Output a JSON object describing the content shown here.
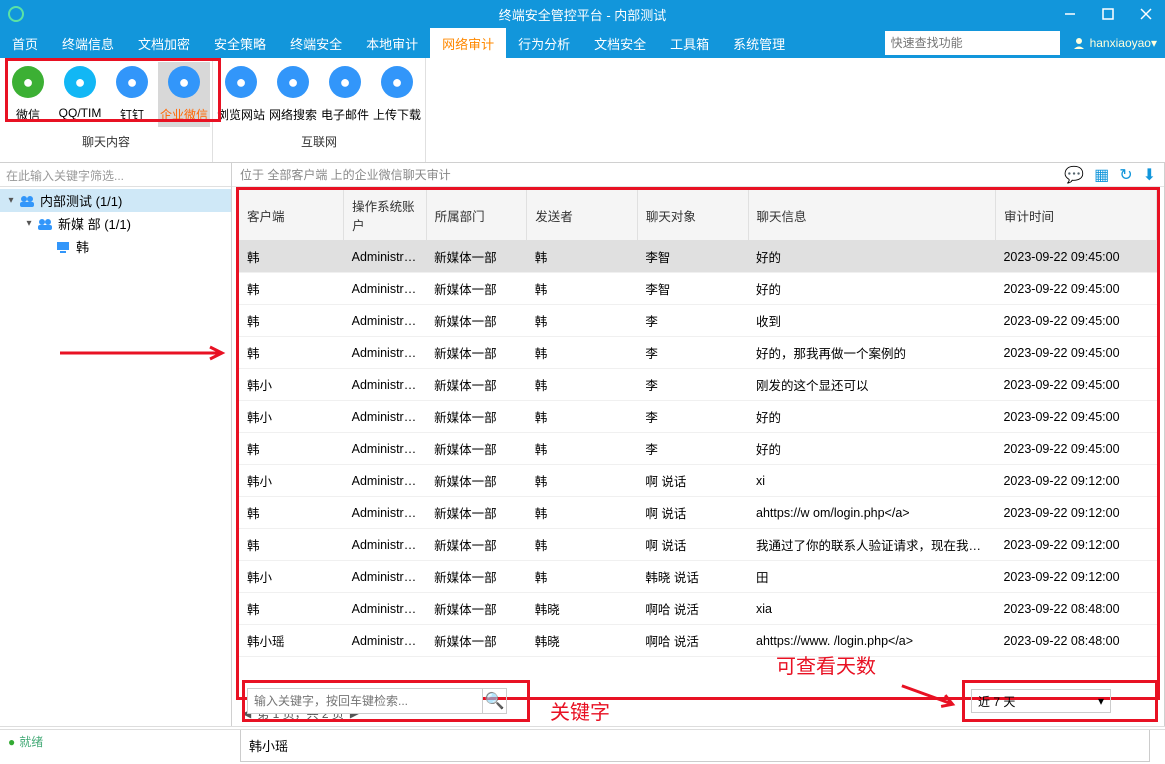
{
  "window": {
    "title": "终端安全管控平台 - 内部测试"
  },
  "user": {
    "name": "hanxiaoyao",
    "suffix": " ▾"
  },
  "search": {
    "placeholder": "快速查找功能"
  },
  "menus": [
    "首页",
    "终端信息",
    "文档加密",
    "安全策略",
    "终端安全",
    "本地审计",
    "网络审计",
    "行为分析",
    "文档安全",
    "工具箱",
    "系统管理"
  ],
  "menu_active": 6,
  "ribbon": {
    "groups": [
      {
        "label": "聊天内容",
        "items": [
          {
            "label": "微信",
            "color": "#3cb034"
          },
          {
            "label": "QQ/TIM",
            "color": "#12b7f5"
          },
          {
            "label": "钉钉",
            "color": "#3296fa"
          },
          {
            "label": "企业微信",
            "color": "#3296fa",
            "active": true
          }
        ]
      },
      {
        "label": "互联网",
        "items": [
          {
            "label": "浏览网站",
            "color": "#3296fa"
          },
          {
            "label": "网络搜索",
            "color": "#3296fa"
          },
          {
            "label": "电子邮件",
            "color": "#3296fa"
          },
          {
            "label": "上传下载",
            "color": "#3296fa"
          }
        ]
      }
    ]
  },
  "sidebar": {
    "filter_placeholder": "在此输入关键字筛选...",
    "nodes": [
      {
        "label": "内部测试 (1/1)",
        "icon": "group",
        "sel": true,
        "depth": 0
      },
      {
        "label": "新媒     部 (1/1)",
        "icon": "group",
        "depth": 1
      },
      {
        "label": "韩",
        "icon": "pc",
        "depth": 2
      }
    ]
  },
  "breadcrumb": "位于 全部客户端 上的企业微信聊天审计",
  "columns": [
    "客户端",
    "操作系统账户",
    "所属部门",
    "发送者",
    "聊天对象",
    "聊天信息",
    "审计时间"
  ],
  "rows": [
    {
      "c": "韩",
      "o": "Administra...",
      "d": "新媒体一部",
      "s": "韩",
      "t": "李智",
      "m": "好的",
      "a": "2023-09-22 09:45:00",
      "sel": true
    },
    {
      "c": "韩",
      "o": "Administra...",
      "d": "新媒体一部",
      "s": "韩",
      "t": "李智",
      "m": "好的",
      "a": "2023-09-22 09:45:00"
    },
    {
      "c": "韩",
      "o": "Administra...",
      "d": "新媒体一部",
      "s": "韩",
      "t": "李",
      "m": "收到",
      "a": "2023-09-22 09:45:00"
    },
    {
      "c": "韩",
      "o": "Administra...",
      "d": "新媒体一部",
      "s": "韩",
      "t": "李",
      "m": "好的，那我再做一个案例的",
      "a": "2023-09-22 09:45:00"
    },
    {
      "c": "韩小",
      "o": "Administra...",
      "d": "新媒体一部",
      "s": "韩",
      "t": "李",
      "m": "刚发的这个显还可以",
      "a": "2023-09-22 09:45:00"
    },
    {
      "c": "韩小",
      "o": "Administra...",
      "d": "新媒体一部",
      "s": "韩",
      "t": "李",
      "m": "好的",
      "a": "2023-09-22 09:45:00"
    },
    {
      "c": "韩",
      "o": "Administra...",
      "d": "新媒体一部",
      "s": "韩",
      "t": "李",
      "m": "好的",
      "a": "2023-09-22 09:45:00"
    },
    {
      "c": "韩小",
      "o": "Administra...",
      "d": "新媒体一部",
      "s": "韩",
      "t": "啊      说话",
      "m": "xi",
      "a": "2023-09-22 09:12:00"
    },
    {
      "c": "韩",
      "o": "Administra...",
      "d": "新媒体一部",
      "s": "韩",
      "t": "啊      说话",
      "m": "ahttps://w          om/login.php</a>",
      "a": "2023-09-22 09:12:00"
    },
    {
      "c": "韩",
      "o": "Administra...",
      "d": "新媒体一部",
      "s": "韩",
      "t": "啊      说话",
      "m": "我通过了你的联系人验证请求，现在我们可...",
      "a": "2023-09-22 09:12:00"
    },
    {
      "c": "韩小",
      "o": "Administra...",
      "d": "新媒体一部",
      "s": "韩",
      "t": "韩晓      说话",
      "m": "田",
      "a": "2023-09-22 09:12:00"
    },
    {
      "c": "韩",
      "o": "Administra...",
      "d": "新媒体一部",
      "s": "韩晓",
      "t": "啊哈   说活",
      "m": "xia",
      "a": "2023-09-22 08:48:00"
    },
    {
      "c": "韩小瑶",
      "o": "Administra...",
      "d": "新媒体一部",
      "s": "韩晓",
      "t": "啊哈   说活",
      "m": "ahttps://www.          /login.php</a>",
      "a": "2023-09-22 08:48:00"
    }
  ],
  "pager": {
    "text": "第 1 页，共 2 页",
    "prev": "◀",
    "next": "▶"
  },
  "chat_head": "韩小瑶",
  "kw": {
    "placeholder": "输入关键字，按回车键检索..."
  },
  "labels": {
    "keyword": "关键字",
    "days": "可查看天数"
  },
  "days_select": "近 7 天",
  "status": {
    "dot": "●",
    "text": "就绪"
  }
}
